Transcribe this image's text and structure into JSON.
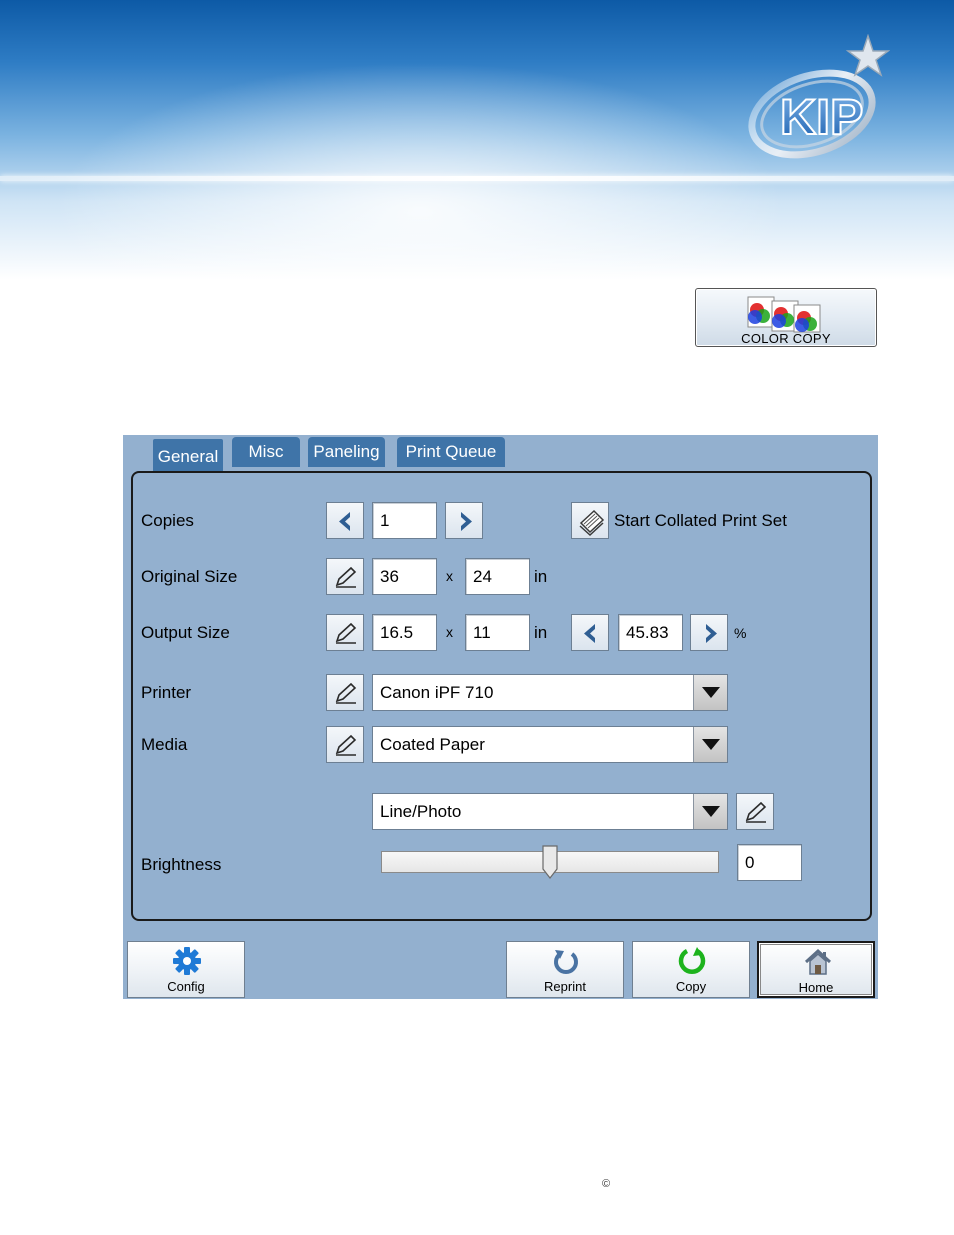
{
  "color_copy_button": {
    "label": "COLOR COPY"
  },
  "tabs": [
    {
      "label": "General",
      "active": true
    },
    {
      "label": "Misc",
      "active": false
    },
    {
      "label": "Paneling",
      "active": false
    },
    {
      "label": "Print Queue",
      "active": false
    }
  ],
  "general": {
    "copies": {
      "label": "Copies",
      "value": "1"
    },
    "collated": {
      "label": "Start Collated Print Set"
    },
    "original_size": {
      "label": "Original Size",
      "width": "36",
      "height": "24",
      "unit": "in",
      "times": "x"
    },
    "output_size": {
      "label": "Output Size",
      "width": "16.5",
      "height": "11",
      "unit": "in",
      "times": "x",
      "scale": "45.83",
      "scale_unit": "%"
    },
    "printer": {
      "label": "Printer",
      "selected": "Canon iPF 710"
    },
    "media": {
      "label": "Media",
      "selected": "Coated Paper"
    },
    "mode": {
      "selected": "Line/Photo"
    },
    "brightness": {
      "label": "Brightness",
      "value": "0",
      "slider_fraction": 0.5
    }
  },
  "bottom_buttons": {
    "config": "Config",
    "reprint": "Reprint",
    "copy": "Copy",
    "home": "Home"
  },
  "footer": {
    "copyright": "©"
  },
  "colors": {
    "panel": "#93b0cf",
    "tab": "#3f74a8",
    "accent_green": "#1db31d",
    "banner_blue": "#0d5aa6"
  }
}
